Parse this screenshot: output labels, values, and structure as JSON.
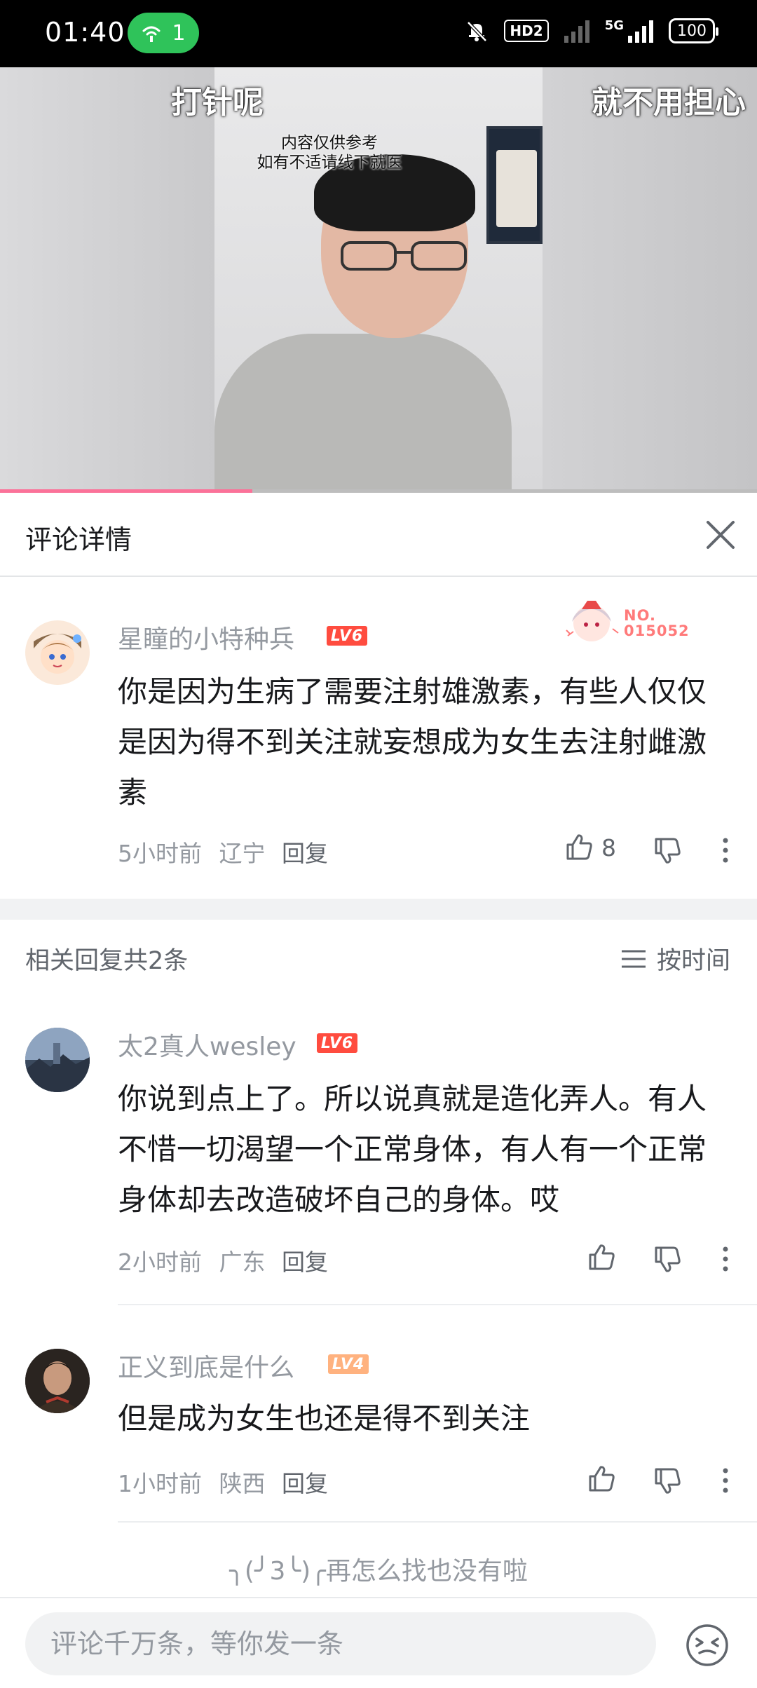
{
  "status_bar": {
    "time": "01:40",
    "hotspot_count": "1",
    "hd_label": "HD2",
    "network": "5G",
    "battery": "100"
  },
  "video": {
    "caption_left": "打针呢",
    "caption_right": "就不用担心",
    "disclaimer_line1": "内容仅供参考",
    "disclaimer_line2": "如有不适请线下就医",
    "progress": 0.333
  },
  "panel": {
    "title": "评论详情"
  },
  "main_comment": {
    "username": "星瞳的小特种兵",
    "level": "LV6",
    "fan_badge_no": "NO.",
    "fan_badge_num": "015052",
    "text": "你是因为生病了需要注射雄激素，有些人仅仅是因为得不到关注就妄想成为女生去注射雌激素",
    "time": "5小时前",
    "location": "辽宁",
    "reply_label": "回复",
    "likes": "8"
  },
  "replies_section": {
    "count_label": "相关回复共2条",
    "sort_label": "按时间"
  },
  "replies": [
    {
      "username": "太2真人wesley",
      "level": "LV6",
      "text": "你说到点上了。所以说真就是造化弄人。有人不惜一切渴望一个正常身体，有人有一个正常身体却去改造破坏自己的身体。哎",
      "time": "2小时前",
      "location": "广东",
      "reply_label": "回复"
    },
    {
      "username": "正义到底是什么",
      "level": "LV4",
      "text": "但是成为女生也还是得不到关注",
      "time": "1小时前",
      "location": "陕西",
      "reply_label": "回复"
    }
  ],
  "footer": {
    "note": "╮(╯3╰)╭再怎么找也没有啦"
  },
  "input": {
    "placeholder": "评论千万条，等你发一条"
  },
  "colors": {
    "accent_pink": "#fb7299",
    "lv6": "#ff4c3f",
    "lv4": "#ffb27f",
    "hotspot_green": "#2fc35a"
  }
}
